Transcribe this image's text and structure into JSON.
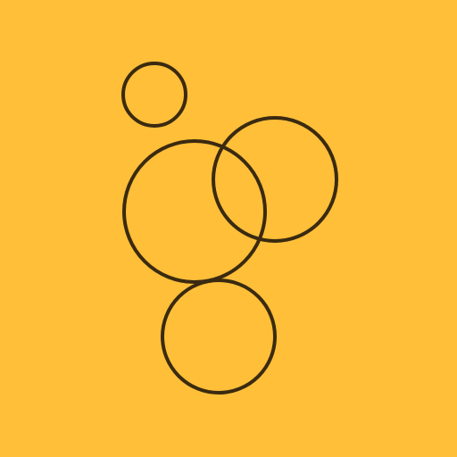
{
  "colors": {
    "background": "#FFBF38",
    "stroke": "#3A2A10"
  },
  "icon": {
    "name": "bubbles-icon",
    "circle_count": 4
  }
}
